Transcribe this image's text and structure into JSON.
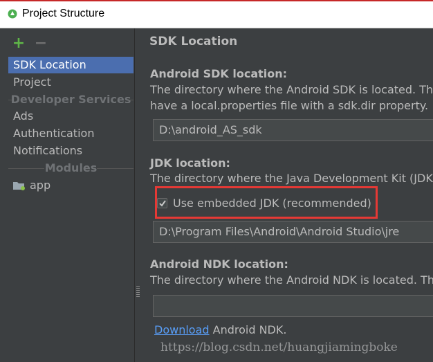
{
  "window": {
    "title": "Project Structure"
  },
  "sidebar": {
    "add_symbol": "+",
    "remove_symbol": "−",
    "items": {
      "sdk_location": "SDK Location",
      "project": "Project"
    },
    "developer_services": {
      "header": "Developer Services",
      "items": [
        "Ads",
        "Authentication",
        "Notifications"
      ]
    },
    "modules": {
      "header": "Modules",
      "items": [
        "app"
      ]
    }
  },
  "panel": {
    "title": "SDK Location",
    "android_sdk": {
      "label": "Android SDK location:",
      "description_line1": "The directory where the Android SDK is located. This l",
      "description_line2": "have a local.properties file with a sdk.dir property.",
      "path": "D:\\android_AS_sdk"
    },
    "jdk": {
      "label": "JDK location:",
      "description": "The directory where the Java Development Kit (JDK) is",
      "use_embedded_label": "Use embedded JDK (recommended)",
      "use_embedded_checked": true,
      "path": "D:\\Program Files\\Android\\Android Studio\\jre"
    },
    "ndk": {
      "label": "Android NDK location:",
      "description": "The directory where the Android NDK is located. This",
      "path": "",
      "download_link": "Download",
      "download_suffix": " Android NDK."
    }
  },
  "watermark": "https://blog.csdn.net/huangjiamingboke",
  "colors": {
    "background": "#3c3f41",
    "selection": "#4b6eaf",
    "link": "#589df6",
    "highlight": "#e53935",
    "add_icon": "#5fb548"
  }
}
